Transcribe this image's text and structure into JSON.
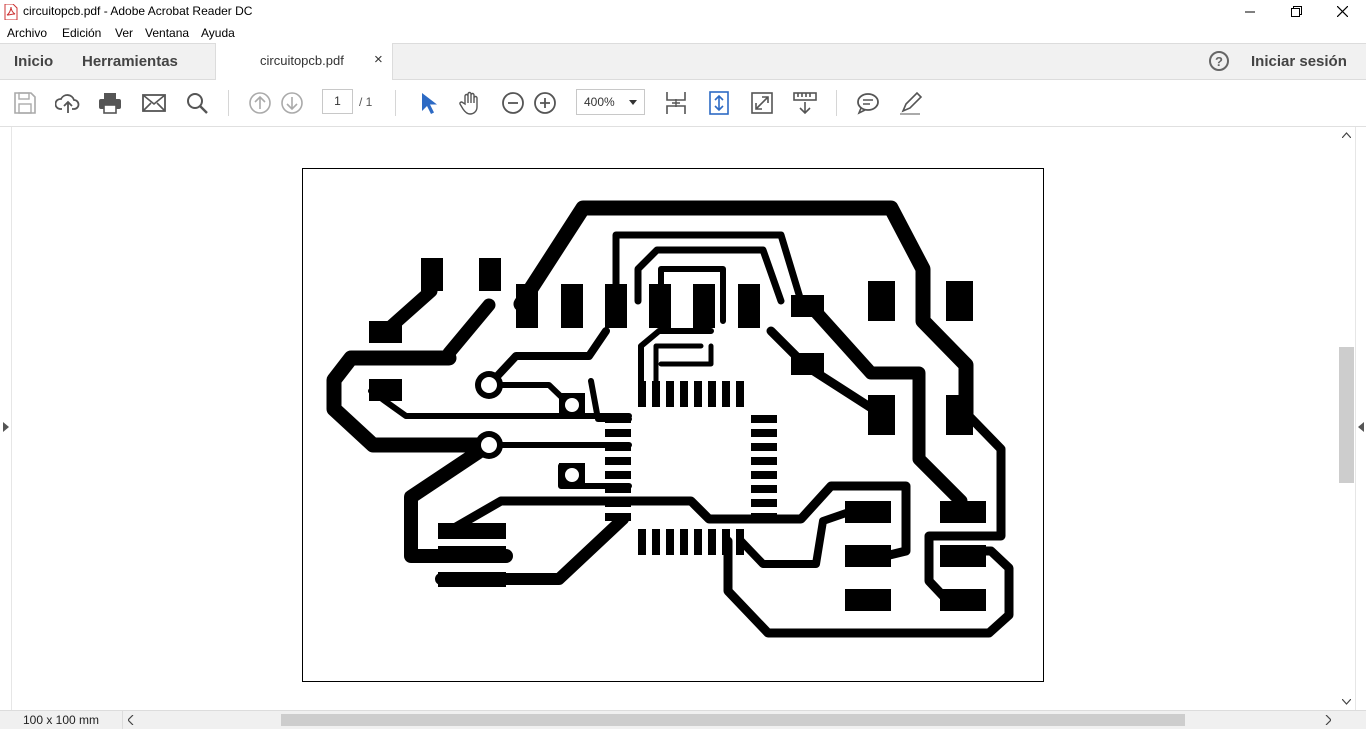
{
  "window": {
    "title": "circuitopcb.pdf - Adobe Acrobat Reader DC"
  },
  "menu": [
    "Archivo",
    "Edición",
    "Ver",
    "Ventana",
    "Ayuda"
  ],
  "nav": {
    "home": "Inicio",
    "tools": "Herramientas",
    "signin": "Iniciar sesión",
    "help": "?"
  },
  "tab": {
    "label": "circuitopcb.pdf",
    "close": "×"
  },
  "toolbar": {
    "page_current": "1",
    "page_total": "/ 1",
    "zoom": "400%",
    "icons": [
      "save-icon",
      "upload-icon",
      "print-icon",
      "email-icon",
      "search-icon",
      "prev-page-icon",
      "next-page-icon",
      "select-arrow-icon",
      "hand-tool-icon",
      "zoom-out-icon",
      "zoom-in-icon",
      "scroll-mode-icon",
      "fit-page-icon",
      "full-screen-icon",
      "read-mode-icon",
      "comment-icon",
      "pen-icon"
    ]
  },
  "status": {
    "page_size": "100 x 100 mm"
  },
  "colors": {
    "accent": "#2d6ac4",
    "trace": "#000000"
  }
}
